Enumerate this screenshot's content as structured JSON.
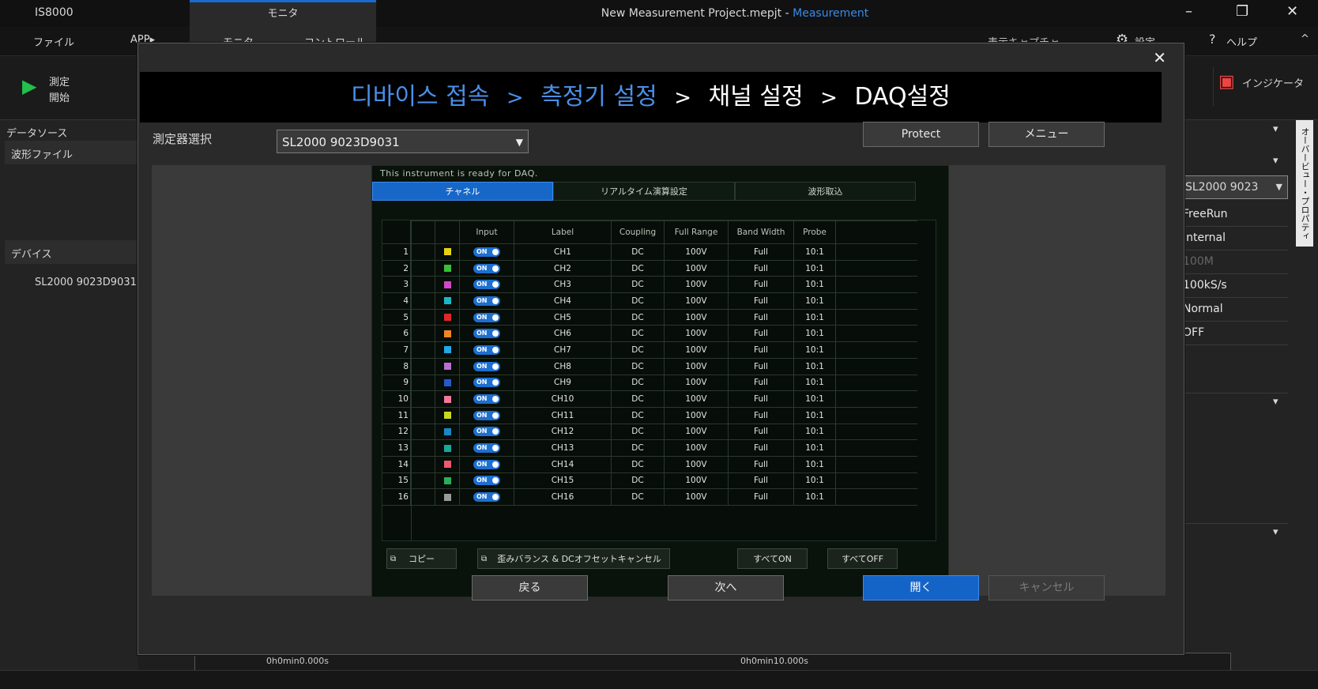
{
  "app": {
    "name": "IS8000",
    "window_title": "New Measurement Project.mepjt",
    "title_sep": " - ",
    "mode": "Measurement",
    "top_tab": "モニタ",
    "menu": [
      "ファイル",
      "APP▸",
      "モニタ",
      "コントロール"
    ],
    "menu_right": [
      "表示キャプチャ",
      "設定",
      "ヘルプ"
    ],
    "ribbon": {
      "start_label_1": "測定",
      "start_label_2": "開始",
      "indicator": "インジケータ"
    }
  },
  "left_panel": {
    "data_source": "データソース",
    "wave_file": "波形ファイル",
    "device": "デバイス",
    "device_item": "SL2000 9023D9031"
  },
  "right_panel": {
    "select_value": "SL2000 9023",
    "rows": [
      "FreeRun",
      "Internal",
      "100M",
      "100kS/s",
      "Normal",
      "OFF"
    ],
    "side_strip": "オーバービュー・プロパティ"
  },
  "bottom": {
    "time_left": "0h0min0.000s",
    "time_right": "0h0min10.000s"
  },
  "dialog": {
    "close": "✕",
    "breadcrumb": {
      "step1": "디바이스 접속",
      "step2": "측정기 설정",
      "step3": "채널 설정",
      "step4": "DAQ설정",
      "sep": ">"
    },
    "instrument_label": "測定器選択",
    "instrument_value": "SL2000 9023D9031",
    "protect": "Protect",
    "menu": "メニュー",
    "ready": "This instrument is ready for DAQ.",
    "tabs": [
      "チャネル",
      "リアルタイム演算設定",
      "波形取込"
    ],
    "columns": [
      "Input",
      "Label",
      "Coupling",
      "Full Range",
      "Band Width",
      "Probe"
    ],
    "channels": [
      {
        "n": "1",
        "label": "CH1",
        "color": "#e8d214",
        "input": "ON",
        "coupling": "DC",
        "range": "100V",
        "bw": "Full",
        "probe": "10:1"
      },
      {
        "n": "2",
        "label": "CH2",
        "color": "#38c038",
        "input": "ON",
        "coupling": "DC",
        "range": "100V",
        "bw": "Full",
        "probe": "10:1"
      },
      {
        "n": "3",
        "label": "CH3",
        "color": "#d048c8",
        "input": "ON",
        "coupling": "DC",
        "range": "100V",
        "bw": "Full",
        "probe": "10:1"
      },
      {
        "n": "4",
        "label": "CH4",
        "color": "#18b8c8",
        "input": "ON",
        "coupling": "DC",
        "range": "100V",
        "bw": "Full",
        "probe": "10:1"
      },
      {
        "n": "5",
        "label": "CH5",
        "color": "#e02828",
        "input": "ON",
        "coupling": "DC",
        "range": "100V",
        "bw": "Full",
        "probe": "10:1"
      },
      {
        "n": "6",
        "label": "CH6",
        "color": "#f08820",
        "input": "ON",
        "coupling": "DC",
        "range": "100V",
        "bw": "Full",
        "probe": "10:1"
      },
      {
        "n": "7",
        "label": "CH7",
        "color": "#20a8e8",
        "input": "ON",
        "coupling": "DC",
        "range": "100V",
        "bw": "Full",
        "probe": "10:1"
      },
      {
        "n": "8",
        "label": "CH8",
        "color": "#b870d0",
        "input": "ON",
        "coupling": "DC",
        "range": "100V",
        "bw": "Full",
        "probe": "10:1"
      },
      {
        "n": "9",
        "label": "CH9",
        "color": "#2858d0",
        "input": "ON",
        "coupling": "DC",
        "range": "100V",
        "bw": "Full",
        "probe": "10:1"
      },
      {
        "n": "10",
        "label": "CH10",
        "color": "#f07898",
        "input": "ON",
        "coupling": "DC",
        "range": "100V",
        "bw": "Full",
        "probe": "10:1"
      },
      {
        "n": "11",
        "label": "CH11",
        "color": "#c8d820",
        "input": "ON",
        "coupling": "DC",
        "range": "100V",
        "bw": "Full",
        "probe": "10:1"
      },
      {
        "n": "12",
        "label": "CH12",
        "color": "#1888c8",
        "input": "ON",
        "coupling": "DC",
        "range": "100V",
        "bw": "Full",
        "probe": "10:1"
      },
      {
        "n": "13",
        "label": "CH13",
        "color": "#18a898",
        "input": "ON",
        "coupling": "DC",
        "range": "100V",
        "bw": "Full",
        "probe": "10:1"
      },
      {
        "n": "14",
        "label": "CH14",
        "color": "#f05870",
        "input": "ON",
        "coupling": "DC",
        "range": "100V",
        "bw": "Full",
        "probe": "10:1"
      },
      {
        "n": "15",
        "label": "CH15",
        "color": "#28b058",
        "input": "ON",
        "coupling": "DC",
        "range": "100V",
        "bw": "Full",
        "probe": "10:1"
      },
      {
        "n": "16",
        "label": "CH16",
        "color": "#9a9a9a",
        "input": "ON",
        "coupling": "DC",
        "range": "100V",
        "bw": "Full",
        "probe": "10:1"
      }
    ],
    "inner_buttons": {
      "copy": "コピー",
      "balance": "歪みバランス & DCオフセットキャンセル",
      "all_on": "すべてON",
      "all_off": "すべてOFF"
    },
    "footer": {
      "back": "戻る",
      "next": "次へ",
      "open": "開く",
      "cancel": "キャンセル"
    }
  }
}
